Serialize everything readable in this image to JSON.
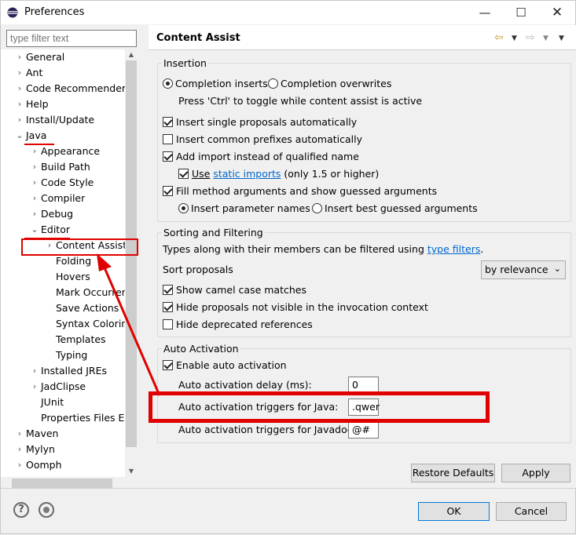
{
  "window": {
    "title": "Preferences"
  },
  "filter": {
    "placeholder": "type filter text"
  },
  "tree": {
    "items": [
      {
        "label": "General"
      },
      {
        "label": "Ant"
      },
      {
        "label": "Code Recommenders"
      },
      {
        "label": "Help"
      },
      {
        "label": "Install/Update"
      },
      {
        "label": "Java"
      },
      {
        "label": "Appearance"
      },
      {
        "label": "Build Path"
      },
      {
        "label": "Code Style"
      },
      {
        "label": "Compiler"
      },
      {
        "label": "Debug"
      },
      {
        "label": "Editor"
      },
      {
        "label": "Content Assist"
      },
      {
        "label": "Folding"
      },
      {
        "label": "Hovers"
      },
      {
        "label": "Mark Occurren"
      },
      {
        "label": "Save Actions"
      },
      {
        "label": "Syntax Coloring"
      },
      {
        "label": "Templates"
      },
      {
        "label": "Typing"
      },
      {
        "label": "Installed JREs"
      },
      {
        "label": "JadClipse"
      },
      {
        "label": "JUnit"
      },
      {
        "label": "Properties Files Ed"
      },
      {
        "label": "Maven"
      },
      {
        "label": "Mylyn"
      },
      {
        "label": "Oomph"
      }
    ]
  },
  "page": {
    "title": "Content Assist"
  },
  "insertion": {
    "label": "Insertion",
    "completion_inserts": "Completion inserts",
    "completion_overwrites": "Completion overwrites",
    "toggle_hint": "Press 'Ctrl' to toggle while content assist is active",
    "single_proposals": "Insert single proposals automatically",
    "common_prefixes": "Insert common prefixes automatically",
    "add_import": "Add import instead of qualified name",
    "use": "Use",
    "static_imports": "static imports",
    "only_15": "(only 1.5 or higher)",
    "fill_method": "Fill method arguments and show guessed arguments",
    "insert_param_names": "Insert parameter names",
    "insert_best_guessed": "Insert best guessed arguments"
  },
  "sorting": {
    "label": "Sorting and Filtering",
    "types_text": "Types along with their members can be filtered using",
    "type_filters": "type filters",
    "period": ".",
    "sort_proposals": "Sort proposals",
    "sort_value": "by relevance",
    "camel_case": "Show camel case matches",
    "hide_not_visible": "Hide proposals not visible in the invocation context",
    "hide_deprecated": "Hide deprecated references"
  },
  "auto": {
    "label": "Auto Activation",
    "enable": "Enable auto activation",
    "delay_label": "Auto activation delay (ms):",
    "delay_value": "0",
    "java_triggers_label": "Auto activation triggers for Java:",
    "java_triggers_value": ".qwer",
    "javadoc_triggers_label": "Auto activation triggers for Javadoc:",
    "javadoc_triggers_value": "@#"
  },
  "buttons": {
    "restore_defaults": "Restore Defaults",
    "apply": "Apply",
    "ok": "OK",
    "cancel": "Cancel"
  },
  "colors": {
    "annotation": "#e00000",
    "link": "#0066cc"
  }
}
